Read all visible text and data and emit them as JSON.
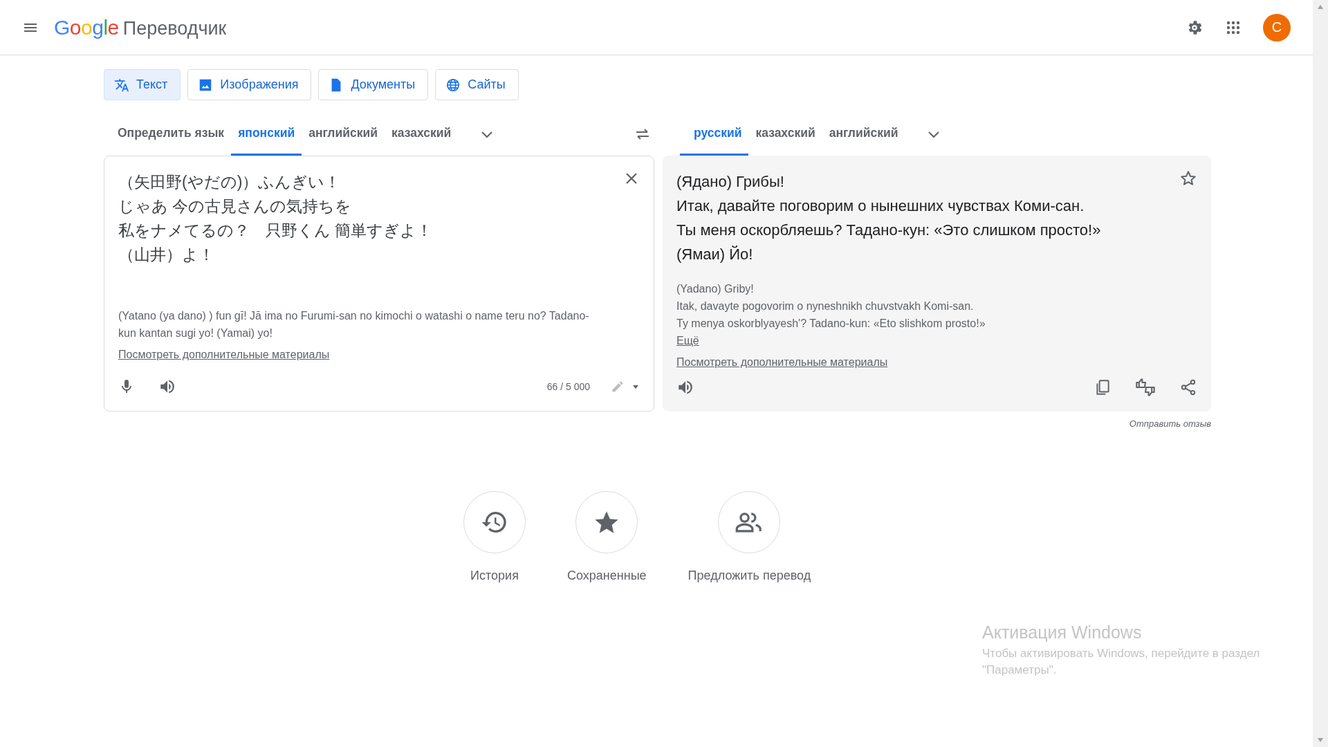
{
  "header": {
    "logo": "Google",
    "product": "Переводчик",
    "avatar": "C"
  },
  "modes": [
    {
      "label": "Текст",
      "kind": "text",
      "selected": true
    },
    {
      "label": "Изображения",
      "kind": "image",
      "selected": false
    },
    {
      "label": "Документы",
      "kind": "document",
      "selected": false
    },
    {
      "label": "Сайты",
      "kind": "web",
      "selected": false
    }
  ],
  "source_languages": [
    {
      "label": "Определить язык",
      "selected": false
    },
    {
      "label": "японский",
      "selected": true
    },
    {
      "label": "английский",
      "selected": false
    },
    {
      "label": "казахский",
      "selected": false
    }
  ],
  "target_languages": [
    {
      "label": "русский",
      "selected": true
    },
    {
      "label": "казахский",
      "selected": false
    },
    {
      "label": "английский",
      "selected": false
    }
  ],
  "source": {
    "lines": [
      "（矢田野(やだの)）ふんぎい！",
      "じゃあ 今の古見さんの気持ちを",
      "私をナメてるの？　只野くん  簡単すぎよ！",
      "（山井）よ！"
    ],
    "transliteration": "(Yatano (ya dano) ) fun gī!  Jā ima no Furumi-san no kimochi o  watashi o name teru no? Tadano-kun  kantan sugi yo! (Yamai) yo!",
    "more_link": "Посмотреть дополнительные материалы",
    "count": "66 / 5 000"
  },
  "target": {
    "lines": [
      "(Ядано) Грибы!",
      "Итак, давайте поговорим о нынешних чувствах Коми-сан.",
      "Ты меня оскорбляешь? Тадано-кун: «Это слишком просто!»",
      "(Ямаи) Йо!"
    ],
    "transliteration": [
      "(Yadano) Griby!",
      "Itak, davayte pogovorim o nyneshnikh chuvstvakh Komi-san.",
      "Ty menya oskorblyayesh'? Tadano-kun: «Eto slishkom prosto!»"
    ],
    "more": "Ещё",
    "more_link": "Посмотреть дополнительные материалы"
  },
  "feedback": "Отправить отзыв",
  "shortcuts": [
    {
      "label": "История",
      "kind": "history"
    },
    {
      "label": "Сохраненные",
      "kind": "saved"
    },
    {
      "label": "Предложить перевод",
      "kind": "contribute"
    }
  ],
  "activation": {
    "title": "Активация Windows",
    "text": "Чтобы активировать Windows, перейдите в раздел \"Параметры\"."
  }
}
